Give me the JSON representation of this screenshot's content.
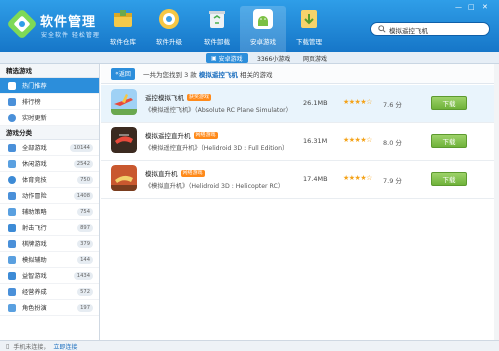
{
  "header": {
    "title": "软件管理",
    "subtitle": "安全软件 轻松管理",
    "search_value": "模拟遥控飞机",
    "nav": [
      {
        "label": "软件仓库",
        "icon": "box-icon"
      },
      {
        "label": "软件升级",
        "icon": "upgrade-icon"
      },
      {
        "label": "软件卸载",
        "icon": "recycle-icon"
      },
      {
        "label": "安卓游戏",
        "icon": "android-icon"
      },
      {
        "label": "下载管理",
        "icon": "download-icon"
      }
    ],
    "window_controls": [
      "—",
      "□",
      "✕"
    ]
  },
  "subbar": {
    "tabs": [
      {
        "label": "安卓游戏"
      },
      {
        "label": "3366小游戏"
      },
      {
        "label": "网页游戏"
      }
    ]
  },
  "sidebar": {
    "featured_header": "精选游戏",
    "featured": [
      {
        "label": "热门推荐",
        "icon": "thumbs-up-icon"
      },
      {
        "label": "排行榜",
        "icon": "ranking-icon"
      },
      {
        "label": "实时更新",
        "icon": "clock-icon"
      }
    ],
    "category_header": "游戏分类",
    "categories": [
      {
        "label": "全部游戏",
        "count": "10144"
      },
      {
        "label": "休闲游戏",
        "count": "2542"
      },
      {
        "label": "体育竞技",
        "count": "750"
      },
      {
        "label": "动作冒险",
        "count": "1408"
      },
      {
        "label": "辅助策略",
        "count": "754"
      },
      {
        "label": "射击飞行",
        "count": "897"
      },
      {
        "label": "棋牌游戏",
        "count": "379"
      },
      {
        "label": "模拟辅助",
        "count": "144"
      },
      {
        "label": "益智游戏",
        "count": "1434"
      },
      {
        "label": "经营养成",
        "count": "572"
      },
      {
        "label": "角色扮演",
        "count": "197"
      }
    ]
  },
  "main": {
    "back_label": "返回",
    "result_prefix": "一共为您找到 3 款",
    "result_keyword": "模拟遥控飞机",
    "result_suffix": "相关的游戏",
    "rows": [
      {
        "name": "遥控模拟飞机",
        "badge": "获奖游戏",
        "desc": "《模拟遥控飞机》（Absolute RC Plane Simulator）",
        "size": "26.1MB",
        "stars": "★★★★☆",
        "score": "7.6 分",
        "download": "下载"
      },
      {
        "name": "模拟遥控直升机",
        "badge": "网络游戏",
        "desc": "《模拟遥控直升机》（Helidroid 3D : Full Edition）",
        "size": "16.31M",
        "stars": "★★★★☆",
        "score": "8.0 分",
        "download": "下载"
      },
      {
        "name": "模拟直升机",
        "badge": "网络游戏",
        "desc": "《模拟直升机》（Helidroid 3D : Helicopter RC）",
        "size": "17.4MB",
        "stars": "★★★★☆",
        "score": "7.9 分",
        "download": "下载"
      }
    ]
  },
  "status": {
    "text": "手机未连接，",
    "link": "立即连接"
  }
}
